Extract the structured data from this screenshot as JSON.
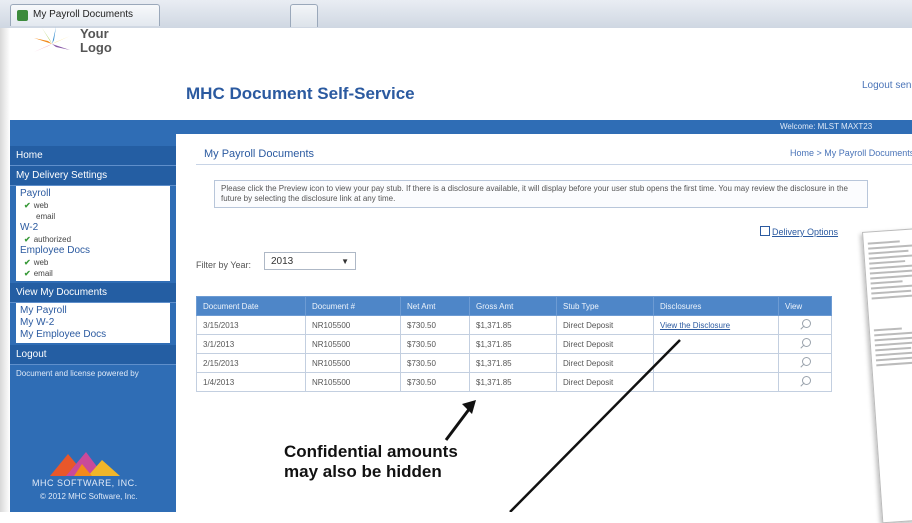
{
  "window": {
    "tab_title": "My Payroll Documents"
  },
  "logo": {
    "line1": "Your",
    "line2": "Logo"
  },
  "header": {
    "title": "MHC Document Self-Service",
    "logout": "Logout sen"
  },
  "welcome": "Welcome: MLST MAXT23",
  "sidebar": {
    "home": "Home",
    "delivery_head": "My Delivery Settings",
    "groups": [
      {
        "label": "Payroll",
        "subs": [
          {
            "text": "web",
            "checked": true
          },
          {
            "text": "email",
            "checked": false
          }
        ]
      },
      {
        "label": "W-2",
        "subs": [
          {
            "text": "authorized",
            "checked": true
          }
        ]
      },
      {
        "label": "Employee Docs",
        "subs": [
          {
            "text": "web",
            "checked": true
          },
          {
            "text": "email",
            "checked": true
          }
        ]
      }
    ],
    "view_head": "View My Documents",
    "view_items": [
      "My Payroll",
      "My W-2",
      "My Employee Docs"
    ],
    "logout": "Logout",
    "footer": "Document and license powered by",
    "brand": "MHC SOFTWARE, INC.",
    "copyright": "© 2012 MHC Software, Inc."
  },
  "main": {
    "section_title": "My Payroll Documents",
    "breadcrumb": "Home > My Payroll Documents",
    "notice": "Please click the Preview icon to view your pay stub. If there is a disclosure available, it will display before your user stub opens the first time. You may review the disclosure in the future by selecting the disclosure link at any time.",
    "delivery_options": "Delivery Options",
    "filter_label": "Filter by Year:",
    "filter_value": "2013",
    "table": {
      "headers": [
        "Document Date",
        "Document #",
        "Net Amt",
        "Gross Amt",
        "Stub Type",
        "Disclosures",
        "View"
      ],
      "rows": [
        [
          "3/15/2013",
          "NR105500",
          "$730.50",
          "$1,371.85",
          "Direct Deposit",
          "View the Disclosure"
        ],
        [
          "3/1/2013",
          "NR105500",
          "$730.50",
          "$1,371.85",
          "Direct Deposit",
          ""
        ],
        [
          "2/15/2013",
          "NR105500",
          "$730.50",
          "$1,371.85",
          "Direct Deposit",
          ""
        ],
        [
          "1/4/2013",
          "NR105500",
          "$730.50",
          "$1,371.85",
          "Direct Deposit",
          ""
        ]
      ]
    }
  },
  "annotation": {
    "line1": "Confidential amounts",
    "line2": "may also be hidden"
  },
  "colors": {
    "brand_blue": "#2f6db5",
    "title_blue": "#2b5aa0",
    "table_header": "#4e86c8"
  }
}
